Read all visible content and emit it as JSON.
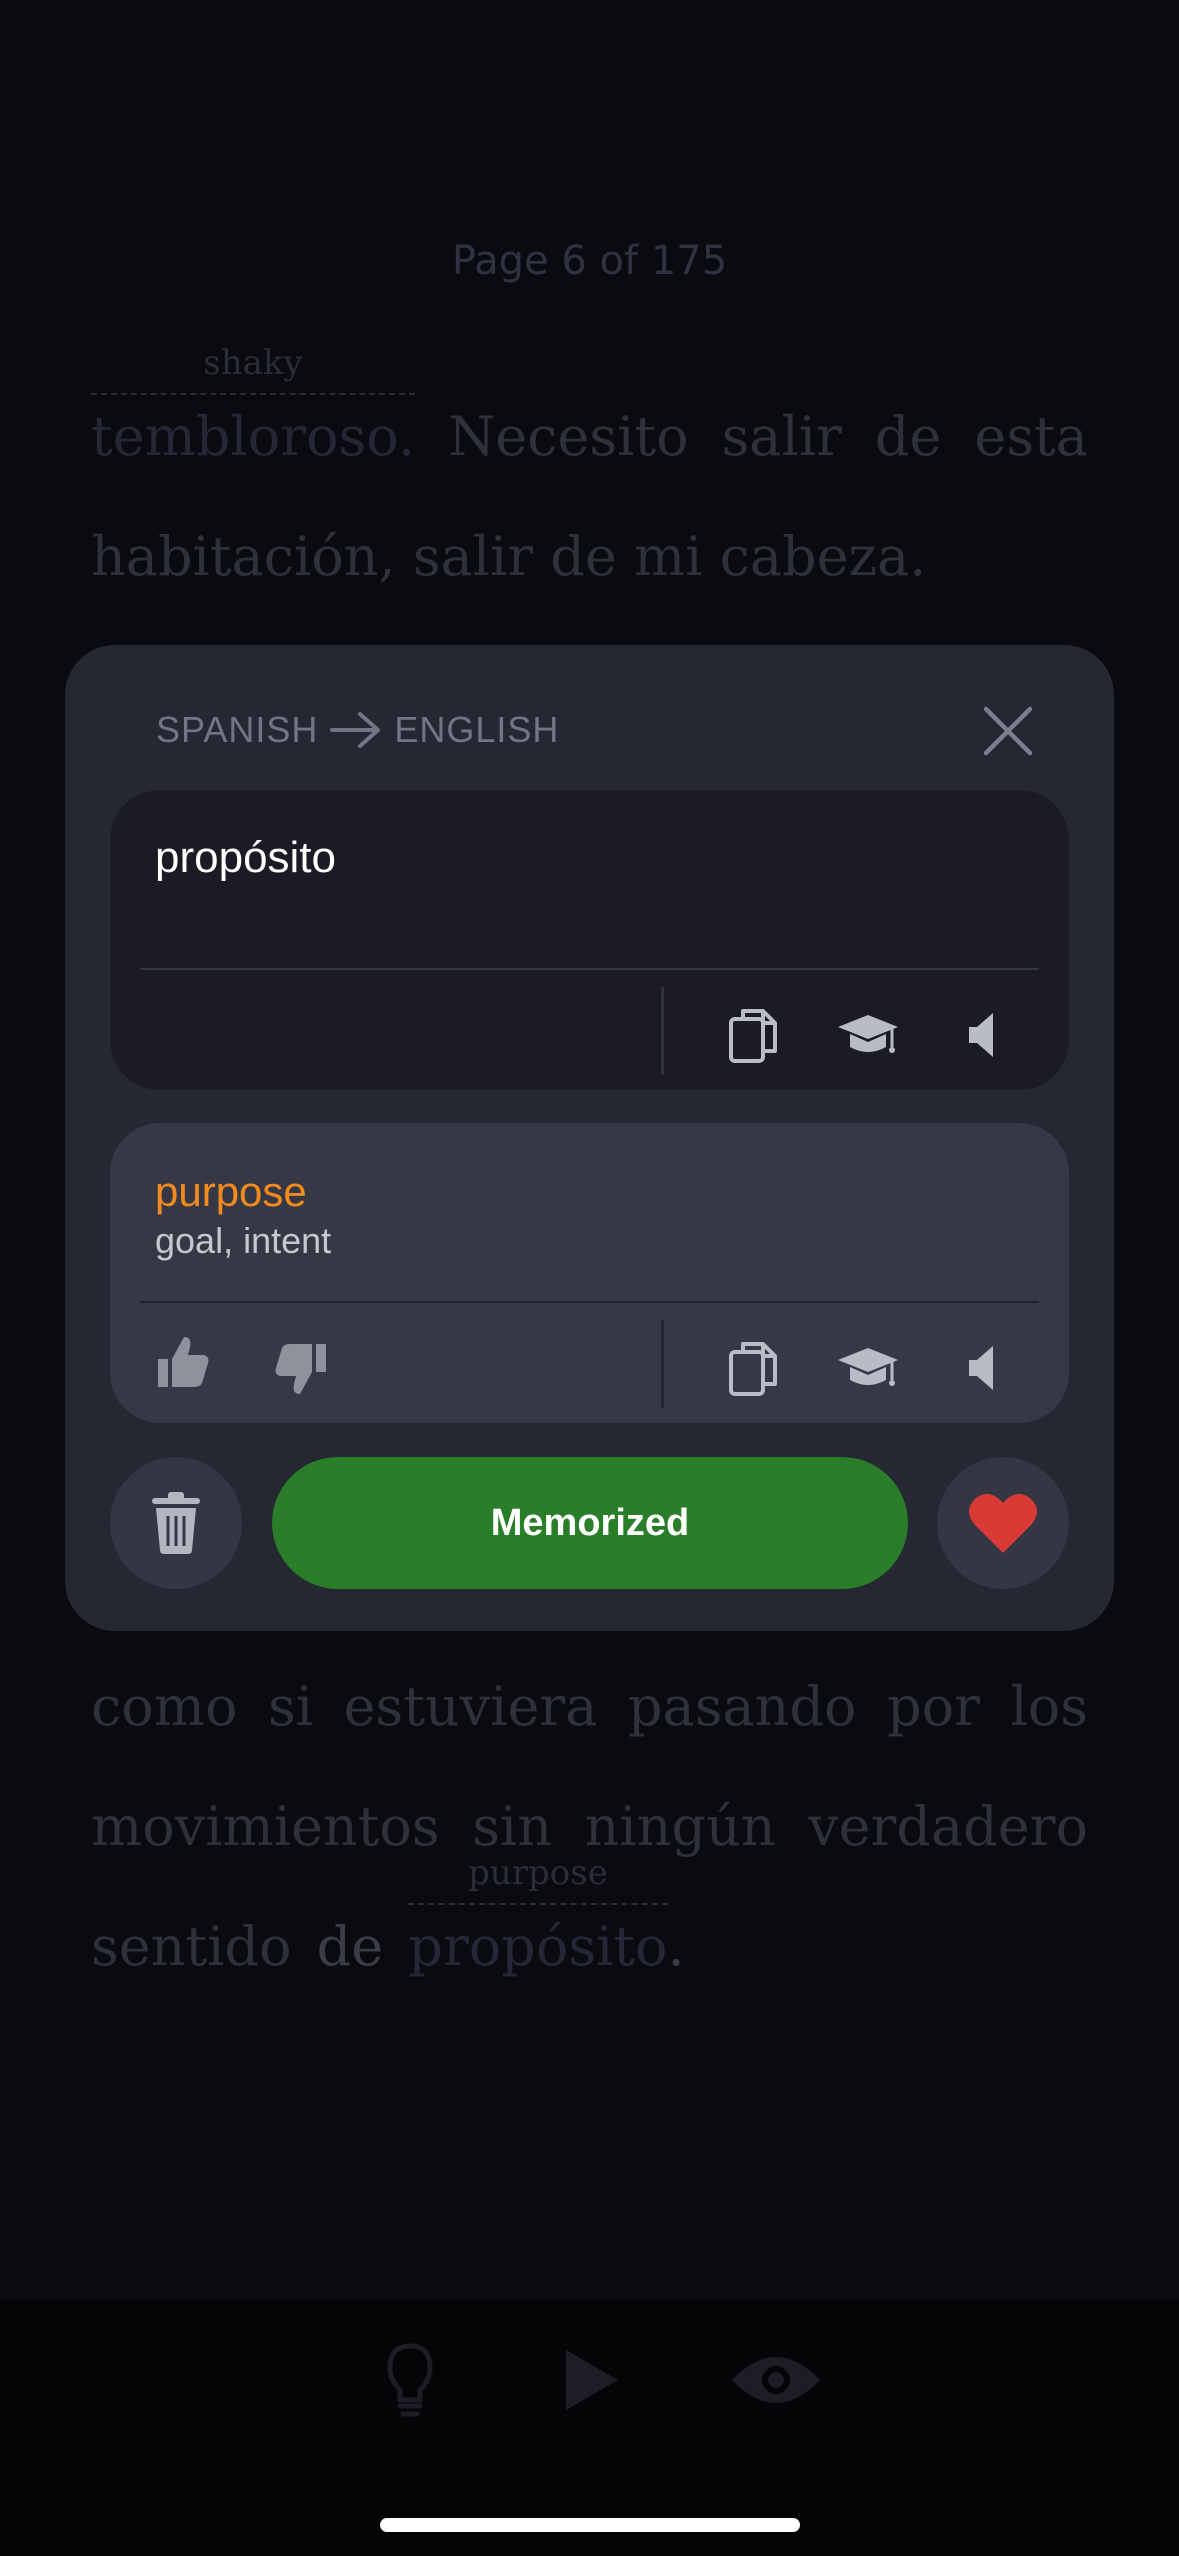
{
  "reader": {
    "page_indicator": "Page 6 of 175",
    "text_top": {
      "line1": {
        "word1": "tembloroso",
        "word1_gloss": "shaky",
        "word1_tail": ".",
        "word2": "Necesito",
        "word3": "salir",
        "word4": "de",
        "word5": "esta"
      },
      "line2": "habitación, salir de mi cabeza."
    },
    "text_bottom": {
      "line1": [
        "como",
        "si",
        "estuviera",
        "pasando",
        "por",
        "los"
      ],
      "line2": [
        "movimientos",
        "sin",
        "ningún",
        "verdadero"
      ],
      "line3": {
        "word1": "sentido",
        "word2": "de",
        "word3": "propósito",
        "word3_gloss": "purpose",
        "tail": "."
      }
    }
  },
  "translation_panel": {
    "source_lang": "SPANISH",
    "target_lang": "ENGLISH",
    "source_text": "propósito",
    "translation_main": "purpose",
    "translation_sub": "goal, intent",
    "memorized_label": "Memorized"
  },
  "colors": {
    "accent_orange": "#f28a1e",
    "memorized_green": "#2a7d29",
    "heart_red": "#d93a36",
    "panel_bg": "#252733"
  },
  "icons": {
    "close": "close-icon",
    "copy": "copy-icon",
    "learn": "graduation-cap-icon",
    "speak": "speaker-icon",
    "like": "thumbs-up-icon",
    "dislike": "thumbs-down-icon",
    "delete": "trash-icon",
    "favorite": "heart-icon",
    "hint": "lightbulb-icon",
    "play": "play-icon",
    "show": "eye-icon"
  }
}
